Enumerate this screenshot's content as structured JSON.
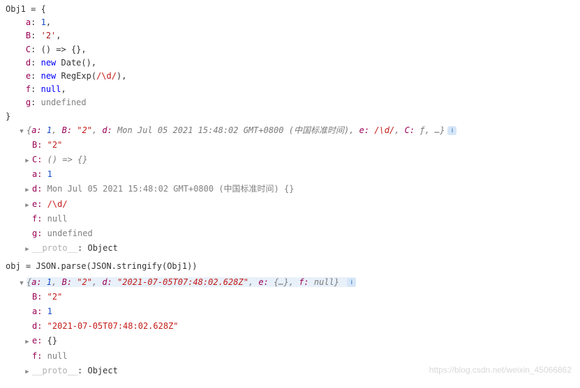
{
  "code": {
    "line1": "Obj1 = {",
    "line2_k": "a",
    "line2_v": "1",
    "line3_k": "B",
    "line3_v": "'2'",
    "line4_k": "C",
    "line4_v": "() => {}",
    "line5_k": "d",
    "line5_v1": "new",
    "line5_v2": " Date()",
    "line6_k": "e",
    "line6_v1": "new",
    "line6_v2": " RegExp(",
    "line6_v3": "/\\d/",
    "line6_v4": ")",
    "line7_k": "f",
    "line7_v": "null",
    "line8_k": "g",
    "line8_v": "undefined",
    "line9": "}"
  },
  "obj1": {
    "summary_parts": {
      "a_k": "a:",
      "a_v": " 1",
      "B_k": "B:",
      "B_v": " \"2\"",
      "d_k": "d:",
      "d_v": " Mon Jul 05 2021 15:48:02 GMT+0800 (中国标准时间)",
      "e_k": "e:",
      "e_v": " /\\d/",
      "C_k": "C:",
      "C_v": " ƒ",
      "ellipsis": ", …"
    },
    "B_k": "B:",
    "B_v": " \"2\"",
    "C_k": "C:",
    "C_v": " () => {}",
    "a_k": "a:",
    "a_v": " 1",
    "d_k": "d:",
    "d_v": " Mon Jul 05 2021 15:48:02 GMT+0800 (中国标准时间) {}",
    "e_k": "e:",
    "e_v": " /\\d/",
    "f_k": "f:",
    "f_v": " null",
    "g_k": "g:",
    "g_v": " undefined",
    "proto_k": "__proto__",
    "proto_v": ": Object"
  },
  "parse_line": "obj = JSON.parse(JSON.stringify(Obj1))",
  "obj2": {
    "summary_parts": {
      "a_k": "a:",
      "a_v": " 1",
      "B_k": "B:",
      "B_v": " \"2\"",
      "d_k": "d:",
      "d_v": " \"2021-07-05T07:48:02.628Z\"",
      "e_k": "e:",
      "e_v": " {…}",
      "f_k": "f:",
      "f_v": " null"
    },
    "B_k": "B:",
    "B_v": " \"2\"",
    "a_k": "a:",
    "a_v": " 1",
    "d_k": "d:",
    "d_v": " \"2021-07-05T07:48:02.628Z\"",
    "e_k": "e:",
    "e_v": " {}",
    "f_k": "f:",
    "f_v": " null",
    "proto_k": "__proto__",
    "proto_v": ": Object"
  },
  "watermark": "https://blog.csdn.net/weixin_45066862"
}
